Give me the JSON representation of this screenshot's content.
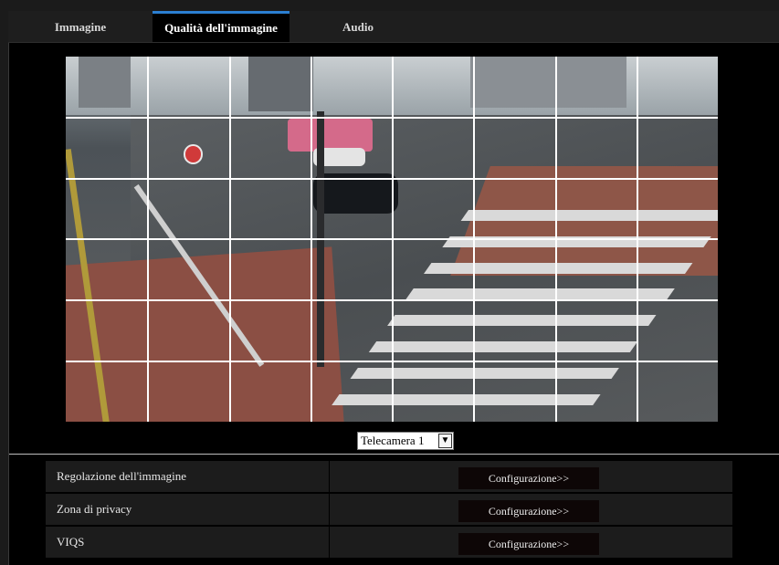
{
  "tabs": [
    {
      "label": "Immagine",
      "active": false
    },
    {
      "label": "Qualità dell'immagine",
      "active": true
    },
    {
      "label": "Audio",
      "active": false
    }
  ],
  "camera_select": {
    "selected": "Telecamera 1"
  },
  "settings_rows": [
    {
      "label": "Regolazione dell'immagine",
      "button": "Configurazione>>"
    },
    {
      "label": "Zona di privacy",
      "button": "Configurazione>>"
    },
    {
      "label": "VIQS",
      "button": "Configurazione>>"
    }
  ],
  "colors": {
    "active_tab_accent": "#2b7fd1",
    "background": "#000000",
    "row_background": "#1c1c1c",
    "button_background": "#0d0606"
  },
  "grid": {
    "columns": 8,
    "rows": 6
  }
}
